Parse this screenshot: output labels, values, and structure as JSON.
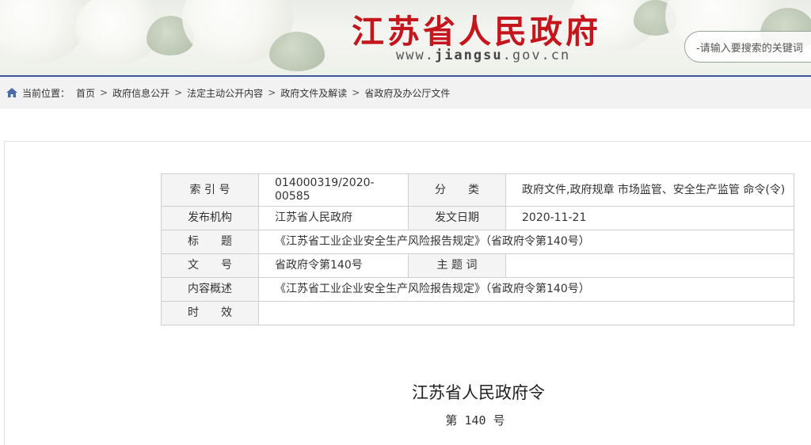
{
  "header": {
    "site_title": "江苏省人民政府",
    "url_prefix": "www.",
    "url_domain": "jiangsu",
    "url_suffix": ".gov.cn",
    "search_placeholder": "-请输入要搜索的关键词"
  },
  "breadcrumb": {
    "label": "当前位置：",
    "items": [
      "首页",
      "政府信息公开",
      "法定主动公开内容",
      "政府文件及解读",
      "省政府及办公厅文件"
    ],
    "separator": ">"
  },
  "meta": {
    "index_label": "索 引 号",
    "index_value": "014000319/2020-00585",
    "category_label": "分　　类",
    "category_value": "政府文件,政府规章 市场监管、安全生产监管 命令(令)",
    "publisher_label": "发布机构",
    "publisher_value": "江苏省人民政府",
    "date_label": "发文日期",
    "date_value": "2020-11-21",
    "title_label": "标　　题",
    "title_value": "《江苏省工业企业安全生产风险报告规定》（省政府令第140号）",
    "docnum_label": "文　　号",
    "docnum_value": "省政府令第140号",
    "keyword_label": "主 题 词",
    "keyword_value": "",
    "summary_label": "内容概述",
    "summary_value": "《江苏省工业企业安全生产风险报告规定》（省政府令第140号）",
    "validity_label": "时　　效",
    "validity_value": ""
  },
  "document": {
    "title": "江苏省人民政府令",
    "number": "第 140 号"
  },
  "colors": {
    "brand_red": "#c4161c",
    "nav_blue": "#3a5a9a"
  }
}
